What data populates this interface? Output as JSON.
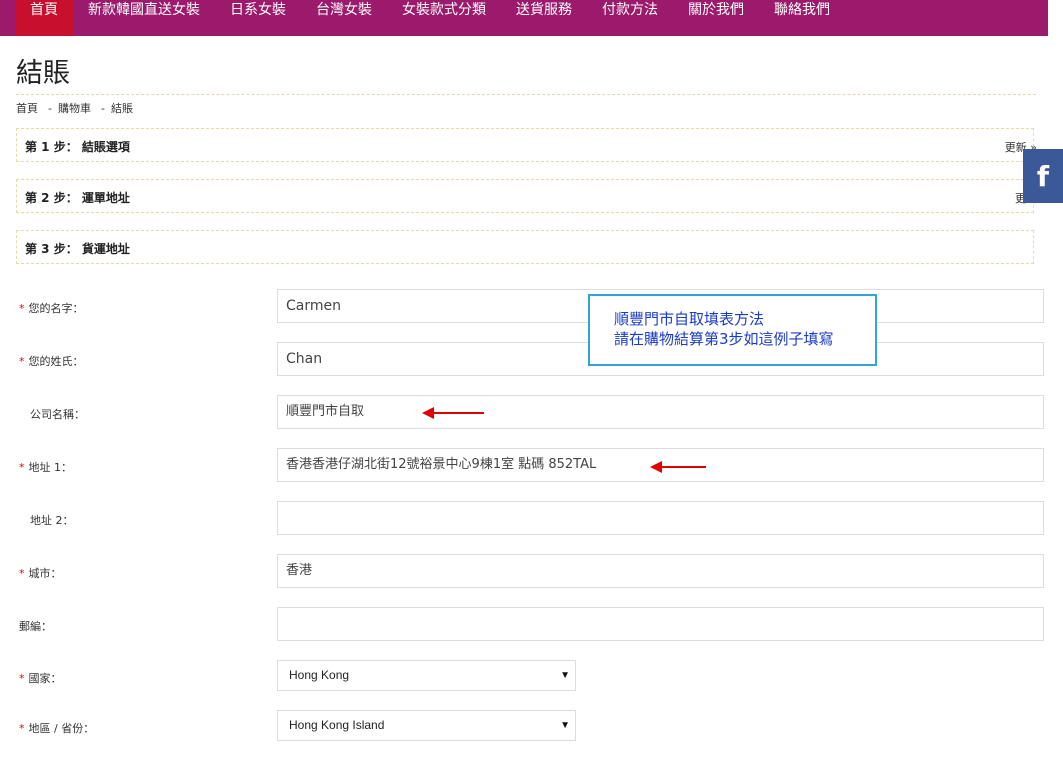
{
  "nav": {
    "items": [
      "首頁",
      "新款韓國直送女裝",
      "日系女裝",
      "台灣女裝",
      "女裝款式分類",
      "送貨服務",
      "付款方法",
      "關於我們",
      "聯絡我們"
    ],
    "active_index": 0,
    "bar_color": "#9b1a6b",
    "active_color": "#c8102e"
  },
  "page": {
    "title": "結賬",
    "breadcrumb": [
      "首頁",
      "購物車",
      "結賬"
    ],
    "breadcrumb_sep": "-"
  },
  "steps": [
    {
      "title": "第 1 步： 結賬選項",
      "edit": "更新 »"
    },
    {
      "title": "第 2 步： 運單地址",
      "edit": "更新"
    },
    {
      "title": "第 3 步： 貨運地址",
      "edit": ""
    }
  ],
  "social": {
    "facebook_glyph": "f",
    "icon": "facebook-icon"
  },
  "form": {
    "required_mark": "*",
    "first_name": {
      "label": "您的名字：",
      "value": "Carmen"
    },
    "last_name": {
      "label": "您的姓氏：",
      "value": "Chan"
    },
    "company": {
      "label": "公司名稱：",
      "value": "順豐門市自取"
    },
    "address1": {
      "label": "地址 1：",
      "value": "香港香港仔湖北街12號裕景中心9棟1室  點碼 852TAL"
    },
    "address2": {
      "label": "地址 2：",
      "value": ""
    },
    "city": {
      "label": "城市：",
      "value": "香港"
    },
    "postcode": {
      "label": "郵編：",
      "value": ""
    },
    "country": {
      "label": "國家：",
      "value": "Hong Kong"
    },
    "region": {
      "label": "地區 / 省份：",
      "value": "Hong Kong Island"
    }
  },
  "note": {
    "line1": "順豐門市自取填表方法",
    "line2": "請在購物結算第3步如這例子填寫",
    "border_color": "#36a3d8",
    "text_color": "#1a3cc8"
  },
  "annotations": {
    "arrow_color": "#e00000"
  }
}
